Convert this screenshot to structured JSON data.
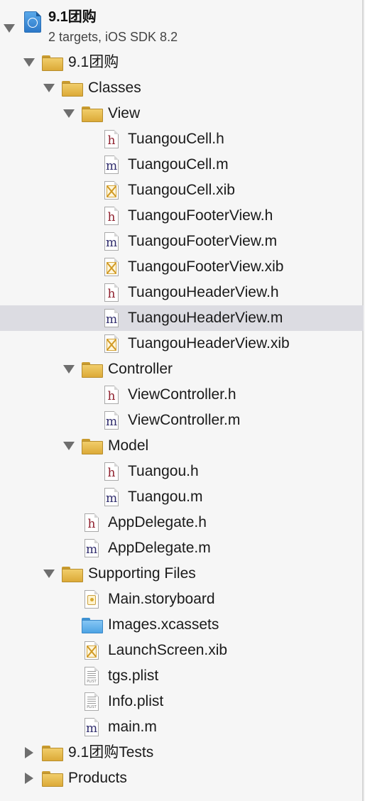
{
  "project": {
    "title": "9.1团购",
    "subtitle": "2 targets, iOS SDK 8.2"
  },
  "tree": [
    {
      "label": "9.1团购",
      "icon": "folder-icon",
      "disclosure": "expanded"
    },
    {
      "label": "Classes",
      "icon": "folder-icon",
      "disclosure": "expanded"
    },
    {
      "label": "View",
      "icon": "folder-icon",
      "disclosure": "expanded"
    },
    {
      "label": "TuangouCell.h",
      "icon": "header-file-icon"
    },
    {
      "label": "TuangouCell.m",
      "icon": "implementation-file-icon"
    },
    {
      "label": "TuangouCell.xib",
      "icon": "xib-file-icon"
    },
    {
      "label": "TuangouFooterView.h",
      "icon": "header-file-icon"
    },
    {
      "label": "TuangouFooterView.m",
      "icon": "implementation-file-icon"
    },
    {
      "label": "TuangouFooterView.xib",
      "icon": "xib-file-icon"
    },
    {
      "label": "TuangouHeaderView.h",
      "icon": "header-file-icon"
    },
    {
      "label": "TuangouHeaderView.m",
      "icon": "implementation-file-icon",
      "selected": true
    },
    {
      "label": "TuangouHeaderView.xib",
      "icon": "xib-file-icon"
    },
    {
      "label": "Controller",
      "icon": "folder-icon",
      "disclosure": "expanded"
    },
    {
      "label": "ViewController.h",
      "icon": "header-file-icon"
    },
    {
      "label": "ViewController.m",
      "icon": "implementation-file-icon"
    },
    {
      "label": "Model",
      "icon": "folder-icon",
      "disclosure": "expanded"
    },
    {
      "label": "Tuangou.h",
      "icon": "header-file-icon"
    },
    {
      "label": "Tuangou.m",
      "icon": "implementation-file-icon"
    },
    {
      "label": "AppDelegate.h",
      "icon": "header-file-icon"
    },
    {
      "label": "AppDelegate.m",
      "icon": "implementation-file-icon"
    },
    {
      "label": "Supporting Files",
      "icon": "folder-icon",
      "disclosure": "expanded"
    },
    {
      "label": "Main.storyboard",
      "icon": "storyboard-file-icon"
    },
    {
      "label": "Images.xcassets",
      "icon": "asset-catalog-folder-icon"
    },
    {
      "label": "LaunchScreen.xib",
      "icon": "xib-file-icon"
    },
    {
      "label": "tgs.plist",
      "icon": "plist-file-icon"
    },
    {
      "label": "Info.plist",
      "icon": "plist-file-icon"
    },
    {
      "label": "main.m",
      "icon": "implementation-file-icon"
    },
    {
      "label": "9.1团购Tests",
      "icon": "folder-icon",
      "disclosure": "collapsed"
    },
    {
      "label": "Products",
      "icon": "folder-icon",
      "disclosure": "collapsed"
    }
  ],
  "icon_glyphs": {
    "header": "h",
    "implementation": "m",
    "plist": "PLIST"
  },
  "colors": {
    "selection": "#dcdce2",
    "folder": "#e8bd4f",
    "asset_folder": "#5fb0ee",
    "header_glyph": "#8e1f2c",
    "impl_glyph": "#2e2b6c"
  }
}
